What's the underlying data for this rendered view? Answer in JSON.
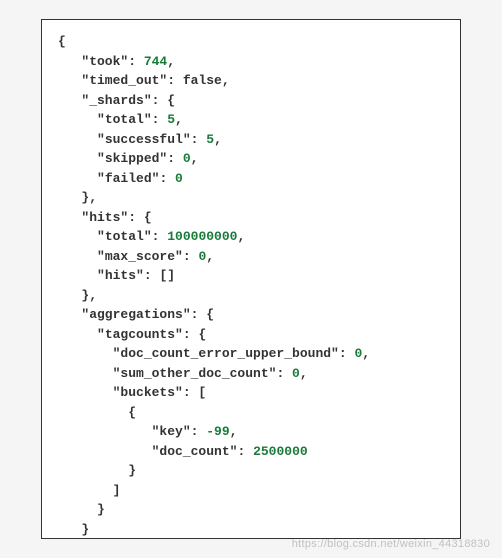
{
  "json": {
    "took": 744,
    "timed_out": false,
    "_shards": {
      "total": 5,
      "successful": 5,
      "skipped": 0,
      "failed": 0
    },
    "hits": {
      "total": 100000000,
      "max_score": 0,
      "hits_array": "[]"
    },
    "aggregations": {
      "tagcounts": {
        "doc_count_error_upper_bound": 0,
        "sum_other_doc_count": 0,
        "buckets": [
          {
            "key": -99,
            "doc_count": 2500000
          }
        ]
      }
    }
  },
  "watermark": "https://blog.csdn.net/weixin_44318830"
}
